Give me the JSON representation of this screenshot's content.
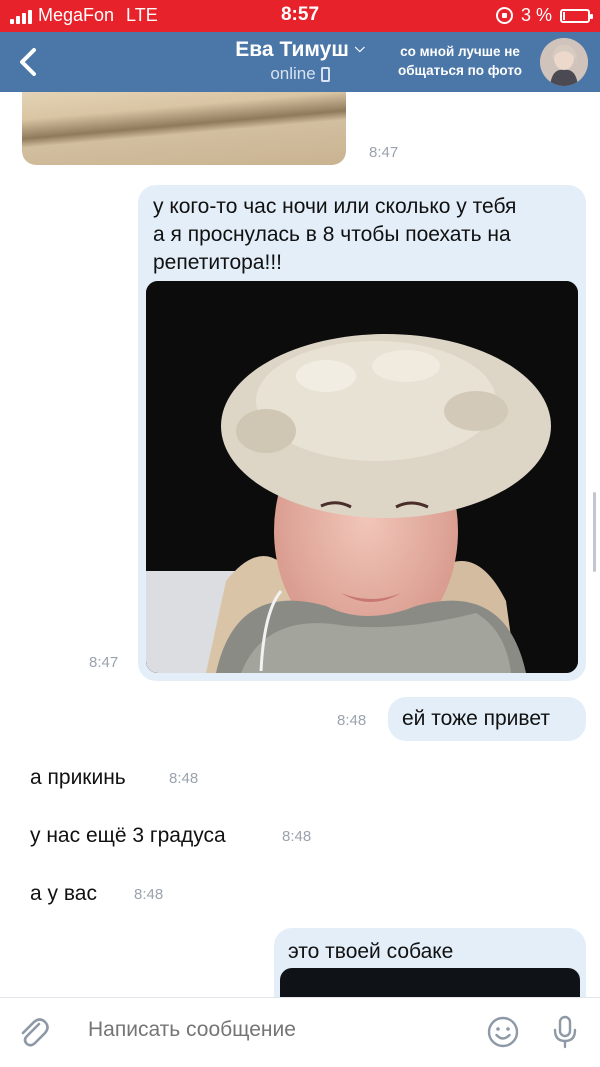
{
  "status_bar": {
    "carrier": "MegaFon",
    "network": "LTE",
    "time": "8:57",
    "battery_text": "3 %",
    "battery_level": 0.03,
    "bg_color": "#e8222b"
  },
  "header": {
    "contact_name": "Ева Тимуш",
    "contact_status": "online",
    "caption": "со мной лучше не общаться по фото",
    "bg_color": "#4a76a8"
  },
  "messages": [
    {
      "type": "photo",
      "direction": "incoming",
      "time": "8:47"
    },
    {
      "type": "text_photo",
      "direction": "outgoing",
      "text": "у кого-то час ночи или сколько у тебя\nа я проснулась в 8 чтобы поехать на\nрепетитора!!!",
      "time": "8:47"
    },
    {
      "type": "text",
      "direction": "outgoing",
      "text": "ей тоже привет",
      "time": "8:48"
    },
    {
      "type": "text",
      "direction": "incoming",
      "text": "а прикинь",
      "time": "8:48"
    },
    {
      "type": "text",
      "direction": "incoming",
      "text": "у нас ещё 3 градуса",
      "time": "8:48"
    },
    {
      "type": "text",
      "direction": "incoming",
      "text": "а у вас",
      "time": "8:48"
    },
    {
      "type": "text_photo",
      "direction": "outgoing",
      "text": "это твоей собаке"
    }
  ],
  "composer": {
    "placeholder": "Написать сообщение"
  },
  "colors": {
    "outgoing_bubble": "#e3eef8",
    "timestamp": "#9aa3ad",
    "placeholder": "#818c99"
  },
  "icons": [
    "back-arrow-icon",
    "chevron-down-icon",
    "phone-icon",
    "attach-icon",
    "emoji-icon",
    "mic-icon"
  ]
}
